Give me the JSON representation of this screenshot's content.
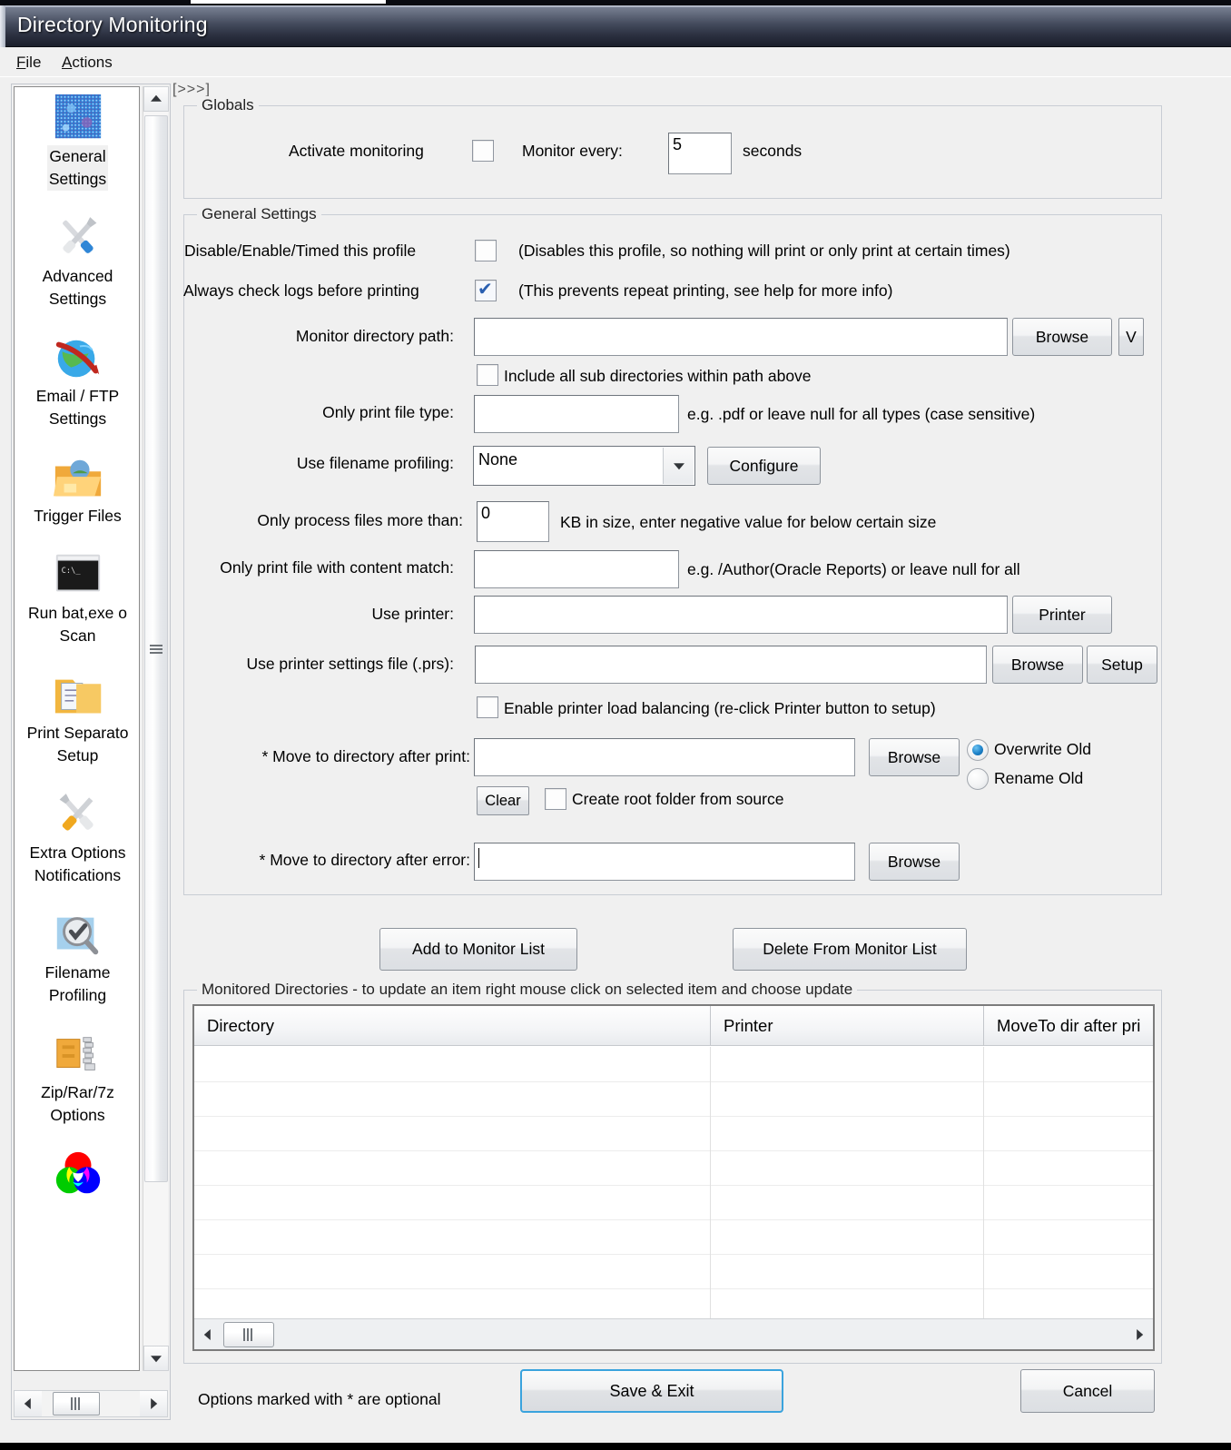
{
  "window": {
    "title": "Directory Monitoring"
  },
  "menu": {
    "items": [
      {
        "label": "File",
        "accel": "F"
      },
      {
        "label": "Actions",
        "accel": "A"
      }
    ]
  },
  "breadcrumb": "[>>>]",
  "sidebar": {
    "items": [
      {
        "label_line1": "General",
        "label_line2": "Settings",
        "icon": "noise-pattern-icon",
        "selected": true
      },
      {
        "label_line1": "Advanced",
        "label_line2": "Settings",
        "icon": "tools-icon",
        "selected": false
      },
      {
        "label_line1": "Email / FTP",
        "label_line2": "Settings",
        "icon": "globe-arrow-icon",
        "selected": false
      },
      {
        "label_line1": "Trigger Files",
        "label_line2": "",
        "icon": "open-folder-icon",
        "selected": false
      },
      {
        "label_line1": "Run bat,exe o",
        "label_line2": "Scan",
        "icon": "console-icon",
        "selected": false
      },
      {
        "label_line1": "Print Separato",
        "label_line2": "Setup",
        "icon": "folder-docs-icon",
        "selected": false
      },
      {
        "label_line1": "Extra Options",
        "label_line2": "Notifications",
        "icon": "tools-gold-icon",
        "selected": false
      },
      {
        "label_line1": "Filename",
        "label_line2": "Profiling",
        "icon": "magnifier-check-icon",
        "selected": false
      },
      {
        "label_line1": "Zip/Rar/7z",
        "label_line2": "Options",
        "icon": "zip-archive-icon",
        "selected": false
      },
      {
        "label_line1": "",
        "label_line2": "",
        "icon": "rgb-circles-icon",
        "selected": false
      }
    ]
  },
  "globals": {
    "legend": "Globals",
    "activate_label": "Activate monitoring",
    "activate_checked": false,
    "monitor_every_label": "Monitor every:",
    "monitor_every_value": "5",
    "seconds_label": "seconds"
  },
  "general": {
    "legend": "General Settings",
    "disable_profile_label": "Disable/Enable/Timed this profile",
    "disable_profile_checked": false,
    "disable_profile_hint": "(Disables this profile, so nothing will print or only print at certain times)",
    "check_logs_label": "Always check logs before printing",
    "check_logs_checked": true,
    "check_logs_hint": "(This prevents repeat printing, see help for more info)",
    "monitor_dir_label": "Monitor directory path:",
    "monitor_dir_value": "",
    "monitor_dir_browse": "Browse",
    "monitor_dir_dropdown": "V",
    "include_sub_label": "Include all sub directories within path above",
    "include_sub_checked": false,
    "file_type_label": "Only print file type:",
    "file_type_value": "",
    "file_type_hint": "e.g. .pdf or leave null for all types (case sensitive)",
    "profiling_label": "Use filename profiling:",
    "profiling_value": "None",
    "profiling_configure": "Configure",
    "min_size_label": "Only process files more than:",
    "min_size_value": "0",
    "min_size_hint": "KB in size, enter negative value for below certain size",
    "content_match_label": "Only print file with content match:",
    "content_match_value": "",
    "content_match_hint": "e.g. /Author(Oracle Reports) or leave null for all",
    "use_printer_label": "Use printer:",
    "use_printer_value": "",
    "use_printer_button": "Printer",
    "prs_label": "Use printer settings file (.prs):",
    "prs_value": "",
    "prs_browse": "Browse",
    "prs_setup": "Setup",
    "load_balancing_label": "Enable printer load balancing (re-click Printer button to setup)",
    "load_balancing_checked": false,
    "move_after_print_label": "* Move to directory after print:",
    "move_after_print_value": "",
    "move_after_print_browse": "Browse",
    "overwrite_old_label": "Overwrite Old",
    "rename_old_label": "Rename Old",
    "overwrite_selected": true,
    "clear_button": "Clear",
    "create_root_label": "Create root folder from source",
    "create_root_checked": false,
    "move_after_error_label": "* Move to directory after error:",
    "move_after_error_value": "",
    "move_after_error_browse": "Browse"
  },
  "actions": {
    "add_button": "Add to Monitor List",
    "delete_button": "Delete From Monitor List"
  },
  "monitored": {
    "legend": "Monitored Directories  -  to update an item right mouse click on selected item and choose update",
    "columns": [
      "Directory",
      "Printer",
      "MoveTo dir after pri"
    ],
    "rows": [
      [],
      [],
      [],
      [],
      [],
      [],
      [],
      []
    ]
  },
  "footer": {
    "note": "Options marked with * are optional",
    "save_button": "Save & Exit",
    "cancel_button": "Cancel"
  },
  "colors": {
    "accent": "#3aa3dd",
    "titlebar_dark": "#1b1f2b",
    "window_bg": "#f0f0f0"
  }
}
